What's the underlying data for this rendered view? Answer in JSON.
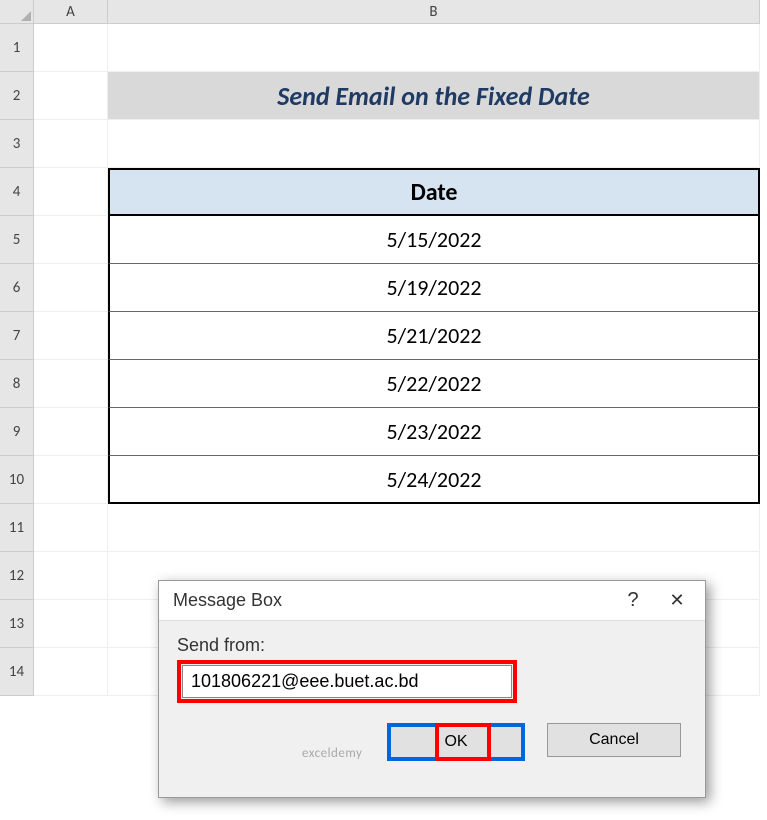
{
  "columns": [
    "A",
    "B"
  ],
  "rows": [
    "1",
    "2",
    "3",
    "4",
    "5",
    "6",
    "7",
    "8",
    "9",
    "10",
    "11",
    "12",
    "13",
    "14"
  ],
  "title": "Send Email on the Fixed Date",
  "table": {
    "header": "Date",
    "dates": [
      "5/15/2022",
      "5/19/2022",
      "5/21/2022",
      "5/22/2022",
      "5/23/2022",
      "5/24/2022"
    ]
  },
  "dialog": {
    "title": "Message Box",
    "label": "Send from:",
    "value": "101806221@eee.buet.ac.bd",
    "ok": "OK",
    "cancel": "Cancel",
    "help": "?",
    "close": "✕"
  },
  "watermark": "exceldemy"
}
